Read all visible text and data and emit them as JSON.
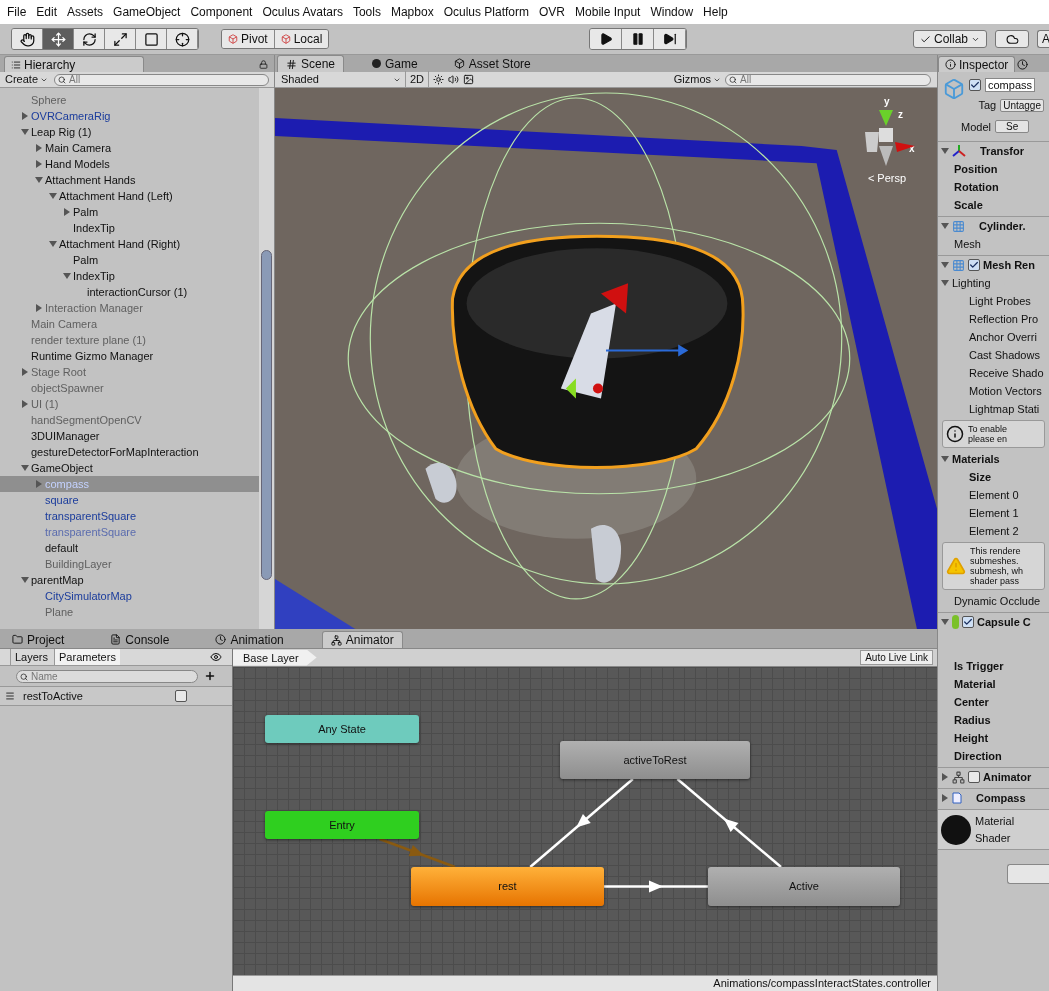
{
  "menu": [
    "File",
    "Edit",
    "Assets",
    "GameObject",
    "Component",
    "Oculus Avatars",
    "Tools",
    "Mapbox",
    "Oculus Platform",
    "OVR",
    "Mobile Input",
    "Window",
    "Help"
  ],
  "toolbar": {
    "tools": [
      {
        "kind": "hand",
        "selected": false
      },
      {
        "kind": "move",
        "selected": true
      },
      {
        "kind": "rotate",
        "selected": false
      },
      {
        "kind": "scale",
        "selected": false
      },
      {
        "kind": "rect",
        "selected": false
      },
      {
        "kind": "transform",
        "selected": false
      }
    ],
    "pivot": "Pivot",
    "space": "Local",
    "playback": [
      {
        "kind": "play"
      },
      {
        "kind": "pause"
      },
      {
        "kind": "step"
      }
    ],
    "collab": "Collab",
    "account": "A"
  },
  "hierarchy": {
    "tab": "Hierarchy",
    "create": "Create",
    "search_placeholder": "All",
    "items": [
      {
        "label": "Sphere",
        "kind": "inactive",
        "selected": false
      },
      {
        "label": "OVRCameraRig",
        "kind": "prefab",
        "expanded": false,
        "selected": false
      },
      {
        "label": "Leap Rig (1)",
        "kind": "normal",
        "expanded": true,
        "selected": false,
        "children": [
          {
            "label": "Main Camera",
            "kind": "normal",
            "expanded": false,
            "selected": false
          },
          {
            "label": "Hand Models",
            "kind": "normal",
            "expanded": false,
            "selected": false
          },
          {
            "label": "Attachment Hands",
            "kind": "normal",
            "expanded": true,
            "selected": false,
            "children": [
              {
                "label": "Attachment Hand (Left)",
                "kind": "normal",
                "expanded": true,
                "selected": false,
                "children": [
                  {
                    "label": "Palm",
                    "kind": "normal",
                    "expanded": false,
                    "selected": false
                  },
                  {
                    "label": "IndexTip",
                    "kind": "normal",
                    "selected": false
                  }
                ]
              },
              {
                "label": "Attachment Hand (Right)",
                "kind": "normal",
                "expanded": true,
                "selected": false,
                "children": [
                  {
                    "label": "Palm",
                    "kind": "normal",
                    "selected": false
                  },
                  {
                    "label": "IndexTip",
                    "kind": "normal",
                    "expanded": true,
                    "selected": false,
                    "children": [
                      {
                        "label": "interactionCursor (1)",
                        "kind": "normal",
                        "selected": false
                      }
                    ]
                  }
                ]
              }
            ]
          },
          {
            "label": "Interaction Manager",
            "kind": "inactive",
            "expanded": false,
            "selected": false
          }
        ]
      },
      {
        "label": "Main Camera",
        "kind": "inactive",
        "selected": false
      },
      {
        "label": "render texture plane (1)",
        "kind": "inactive",
        "selected": false
      },
      {
        "label": "Runtime Gizmo Manager",
        "kind": "normal",
        "selected": false
      },
      {
        "label": "Stage Root",
        "kind": "inactive",
        "expanded": false,
        "selected": false
      },
      {
        "label": "objectSpawner",
        "kind": "inactive",
        "selected": false
      },
      {
        "label": "UI (1)",
        "kind": "inactive",
        "expanded": false,
        "selected": false
      },
      {
        "label": "handSegmentOpenCV",
        "kind": "inactive",
        "selected": false
      },
      {
        "label": "3DUIManager",
        "kind": "normal",
        "selected": false
      },
      {
        "label": "gestureDetectorForMapInteraction",
        "kind": "normal",
        "selected": false
      },
      {
        "label": "GameObject",
        "kind": "normal",
        "expanded": true,
        "selected": false,
        "children": [
          {
            "label": "compass",
            "kind": "prefab",
            "expanded": false,
            "selected": true
          },
          {
            "label": "square",
            "kind": "prefab",
            "selected": false
          },
          {
            "label": "transparentSquare",
            "kind": "prefab",
            "selected": false
          },
          {
            "label": "transparentSquare",
            "kind": "prefab_inactive",
            "selected": false
          },
          {
            "label": "default",
            "kind": "normal",
            "selected": false
          },
          {
            "label": "BuildingLayer",
            "kind": "inactive",
            "selected": false
          }
        ]
      },
      {
        "label": "parentMap",
        "kind": "normal",
        "expanded": true,
        "selected": false,
        "children": [
          {
            "label": "CitySimulatorMap",
            "kind": "prefab",
            "selected": false
          },
          {
            "label": "Plane",
            "kind": "inactive",
            "selected": false
          }
        ]
      }
    ]
  },
  "scene": {
    "tabs": [
      {
        "label": "Scene",
        "kind": "scene",
        "selected": true
      },
      {
        "label": "Game",
        "kind": "game",
        "selected": false
      },
      {
        "label": "Asset Store",
        "kind": "store",
        "selected": false
      }
    ],
    "shading": "Shaded",
    "mode_2d": "2D",
    "gizmos": "Gizmos",
    "search_placeholder": "All",
    "axes": [
      "y",
      "z",
      "x"
    ],
    "projection": "< Persp"
  },
  "inspector": {
    "tab": "Inspector",
    "object": {
      "active": true,
      "name": "compass",
      "tag_label": "Tag",
      "tag": "Untagge",
      "model_label": "Model",
      "model_button": "Se"
    },
    "components": [
      {
        "kind": "transform",
        "title": "Transfor",
        "expanded": true,
        "rows": [
          {
            "label": "Position",
            "kind": "bold"
          },
          {
            "label": "Rotation",
            "kind": "bold"
          },
          {
            "label": "Scale",
            "kind": "bold"
          }
        ]
      },
      {
        "kind": "mesh",
        "title": "Cylinder.",
        "expanded": true,
        "rows": [
          {
            "label": "Mesh",
            "kind": "plain"
          }
        ]
      },
      {
        "kind": "renderer",
        "title": "Mesh Ren",
        "expanded": true,
        "enabled": true,
        "rows": [
          {
            "label": "Lighting",
            "kind": "foldout",
            "expanded": true
          },
          {
            "label": "Light Probes",
            "kind": "sub"
          },
          {
            "label": "Reflection Pro",
            "kind": "sub"
          },
          {
            "label": "Anchor Overri",
            "kind": "sub"
          },
          {
            "label": "Cast Shadows",
            "kind": "sub"
          },
          {
            "label": "Receive Shado",
            "kind": "sub"
          },
          {
            "label": "Motion Vectors",
            "kind": "sub"
          },
          {
            "label": "Lightmap Stati",
            "kind": "sub"
          },
          {
            "label": "To enable\nplease en",
            "kind": "info"
          },
          {
            "label": "Materials",
            "kind": "foldout_bold",
            "expanded": true
          },
          {
            "label": "Size",
            "kind": "sub_bold"
          },
          {
            "label": "Element 0",
            "kind": "sub"
          },
          {
            "label": "Element 1",
            "kind": "sub"
          },
          {
            "label": "Element 2",
            "kind": "sub"
          },
          {
            "label": "This rendere\nsubmeshes.\nsubmesh, wh\nshader pass",
            "kind": "warning"
          },
          {
            "label": "Dynamic Occlude",
            "kind": "plain"
          }
        ]
      },
      {
        "kind": "collider",
        "title": "Capsule C",
        "expanded": true,
        "enabled": true,
        "rows": [
          {
            "label": "Is Trigger",
            "kind": "bold"
          },
          {
            "label": "Material",
            "kind": "bold"
          },
          {
            "label": "Center",
            "kind": "bold"
          },
          {
            "label": "Radius",
            "kind": "bold"
          },
          {
            "label": "Height",
            "kind": "bold"
          },
          {
            "label": "Direction",
            "kind": "bold"
          }
        ]
      },
      {
        "kind": "animator",
        "title": "Animator",
        "expanded": false,
        "enabled": false
      },
      {
        "kind": "script",
        "title": "Compass",
        "expanded": false
      }
    ],
    "material": {
      "label": "Material",
      "shader_label": "Shader"
    }
  },
  "bottom": {
    "tabs": [
      {
        "label": "Project",
        "kind": "folder",
        "selected": false
      },
      {
        "label": "Console",
        "kind": "console",
        "selected": false
      },
      {
        "label": "Animation",
        "kind": "clock",
        "selected": false
      },
      {
        "label": "Animator",
        "kind": "animator",
        "selected": true
      }
    ],
    "side_tabs": [
      {
        "label": "Layers",
        "selected": false
      },
      {
        "label": "Parameters",
        "selected": true
      }
    ],
    "search_placeholder": "Name",
    "parameters": [
      {
        "name": "restToActive",
        "value": false
      }
    ],
    "breadcrumb": "Base Layer",
    "live_link": "Auto Live Link",
    "nodes": [
      {
        "label": "Any State",
        "kind": "any"
      },
      {
        "label": "Entry",
        "kind": "entry"
      },
      {
        "label": "activeToRest",
        "kind": "state"
      },
      {
        "label": "rest",
        "kind": "default"
      },
      {
        "label": "Active",
        "kind": "state"
      }
    ],
    "path": "Animations/compassInteractStates.controller"
  }
}
